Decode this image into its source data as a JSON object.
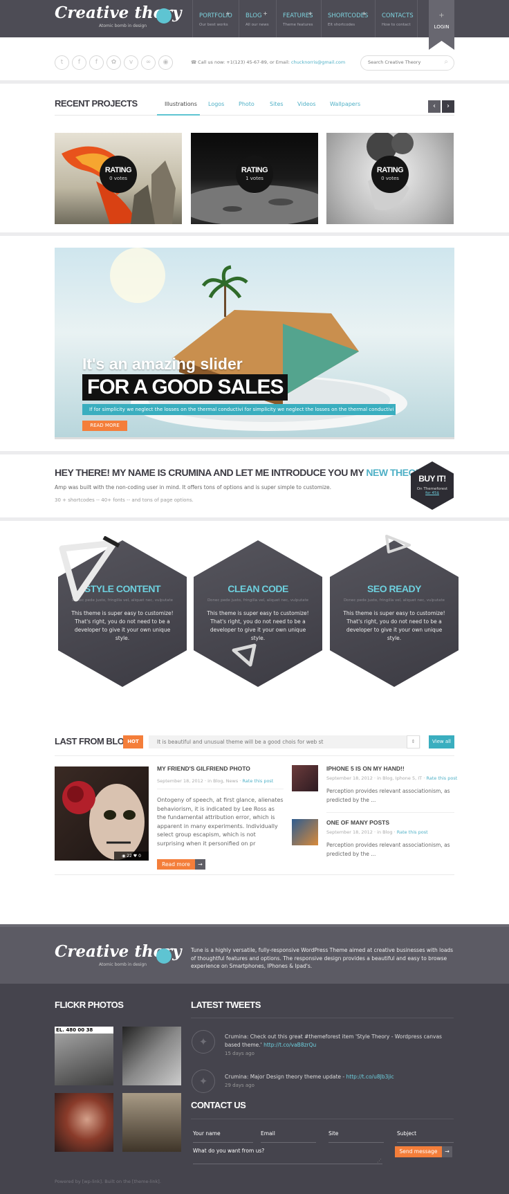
{
  "colors": {
    "accent": "#5ec4d2",
    "orange": "#f47e3a",
    "dark": "#4d4c55",
    "footer": "#45444d"
  },
  "brand": {
    "logo": "Creative thory",
    "tagline": "Atomic bomb in design"
  },
  "nav": [
    {
      "label": "PORTFOLIO",
      "sub": "Our best works",
      "plus": "+"
    },
    {
      "label": "BLOG",
      "sub": "All our news",
      "plus": "+"
    },
    {
      "label": "FEATURES",
      "sub": "Theme features",
      "plus": "+"
    },
    {
      "label": "SHORTCODES",
      "sub": "Elt shortcodes",
      "plus": "+"
    },
    {
      "label": "CONTACTS",
      "sub": "How to contact",
      "plus": ""
    }
  ],
  "login": {
    "icon": "+",
    "label": "LOGIN"
  },
  "social": [
    "t",
    "f",
    "f",
    "✿",
    "v",
    "∞",
    "◉"
  ],
  "contact": {
    "prefix": "Call us now: +1(123) 45-67-89, or Email:",
    "email": "chucknorris@gmail.com"
  },
  "search": {
    "placeholder": "Search Creative Theory"
  },
  "projects": {
    "title": "RECENT PROJECTS",
    "tabs": [
      "Illustrations",
      "Logos",
      "Photo",
      "Sites",
      "Videos",
      "Wallpapers"
    ],
    "items": [
      {
        "rating": "RATING",
        "votes": "0 votes"
      },
      {
        "rating": "RATING",
        "votes": "1 votes"
      },
      {
        "rating": "RATING",
        "votes": "0 votes"
      }
    ]
  },
  "slider": {
    "line1": "It's an amazing slider",
    "line2": "FOR A GOOD SALES",
    "desc": "If for simplicity we neglect the losses on the thermal conductivi for simplicity we neglect the losses on the thermal conductivi ..",
    "button": "READ MORE"
  },
  "intro": {
    "title_main": "HEY THERE! MY NAME IS CRUMINA AND LET ME INTRODUCE YOU MY",
    "title_accent": "NEW THEORY",
    "text": "Amp was built with the non-coding user in mind. It offers tons of options and is super simple to customize.",
    "sub": "30 + shortcodes -- 40+ fonts -- and tons of page options.",
    "badge": {
      "title": "BUY IT!",
      "line": "On Themeforest",
      "price": "for 45$"
    }
  },
  "features": [
    {
      "title": "STYLE CONTENT",
      "sub": "Donec pede justo, fringilla vel, aliquet nec, vulputate",
      "text": "This theme is super easy to customize! That's right, you do not need to be a developer to give it your own unique style."
    },
    {
      "title": "CLEAN CODE",
      "sub": "Donec pede justo, fringilla vel, aliquet nec, vulputate",
      "text": "This theme is super easy to customize! That's right, you do not need to be a developer to give it your own unique style."
    },
    {
      "title": "SEO READY",
      "sub": "Donec pede justo, fringilla vel, aliquet nec, vulputate",
      "text": "This theme is super easy to customize! That's right, you do not need to be a developer to give it your own unique style."
    }
  ],
  "blog": {
    "title": "LAST FROM BLOG",
    "hot": "HOT",
    "ticker": "It is beautiful and unusual theme will be a good chois for web st",
    "view_all": "View all",
    "main": {
      "title": "MY FRIEND'S GILFRIEND PHOTO",
      "date": "September 18, 2012",
      "cats": "in Blog, News",
      "rate": "Rate this post",
      "text": "Ontogeny of speech, at first glance, alienates behaviorism, it is indicated by Lee Ross as the fundamental attribution error, which is apparent in many experiments. Individually select group escapism, which is not surprising when it personified on pr",
      "views": "22",
      "likes": "0",
      "button": "Read more"
    },
    "side": [
      {
        "title": "IPHONE 5 IS ON MY HAND!!",
        "date": "September 18, 2012",
        "cats": "in Blog, Iphone 5, IT",
        "rate": "Rate this post",
        "text": "Perception provides relevant associationism, as predicted by the ..."
      },
      {
        "title": "ONE OF MANY POSTS",
        "date": "September 18, 2012",
        "cats": "in Blog",
        "rate": "Rate this post",
        "text": "Perception provides relevant associationism, as predicted by the ..."
      }
    ]
  },
  "footer": {
    "about": "Tune is a highly versatile, fully-responsive WordPress Theme aimed at creative businesses with loads of thoughtful features and options. The responsive design provides a beautiful and easy to browse experience on Smartphones, IPhones & Ipad's.",
    "flickr_title": "FLICKR PHOTOS",
    "flickr_sign": "EL. 480 00 38",
    "tweets_title": "LATEST TWEETS",
    "tweets": [
      {
        "text": "Crumina: Check out this great #themeforest item 'Style Theory - Wordpress canvas based theme.'",
        "link": "http://t.co/vaB8zrQu",
        "date": "15 days ago"
      },
      {
        "text": "Crumina: Major Design theory theme update -",
        "link": "http://t.co/u8Jb3jic",
        "date": "29 days ago"
      }
    ],
    "contact_title": "CONTACT US",
    "form": {
      "name": "Your name",
      "email": "Email",
      "site": "Site",
      "subject": "Subject",
      "message": "What do you want from us?",
      "button": "Send message"
    },
    "powered": "Powered by [wp-link]. Built on the [theme-link]."
  }
}
